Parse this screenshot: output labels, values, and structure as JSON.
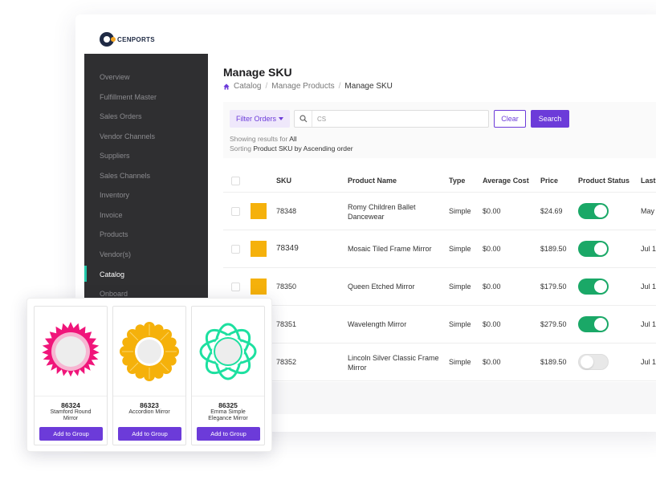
{
  "brand": {
    "name": "CENPORTS"
  },
  "sidebar": {
    "items": [
      {
        "label": "Overview"
      },
      {
        "label": "Fulfillment Master"
      },
      {
        "label": "Sales Orders"
      },
      {
        "label": "Vendor Channels"
      },
      {
        "label": "Suppliers"
      },
      {
        "label": "Sales Channels"
      },
      {
        "label": "Inventory"
      },
      {
        "label": "Invoice"
      },
      {
        "label": "Products"
      },
      {
        "label": "Vendor(s)"
      },
      {
        "label": "Catalog",
        "active": true
      },
      {
        "label": "Onboard"
      }
    ],
    "active_color": "#22c7a9"
  },
  "page": {
    "title": "Manage SKU",
    "breadcrumb": [
      "Catalog",
      "Manage Products",
      "Manage SKU"
    ]
  },
  "toolbar": {
    "filter_label": "Filter Orders",
    "search_value": "CS",
    "clear_label": "Clear",
    "search_label": "Search",
    "showing_prefix": "Showing results for",
    "showing_value": "All",
    "sorting_prefix": "Sorting",
    "sorting_value": "Product SKU by Ascending order"
  },
  "table": {
    "headers": {
      "sku": "SKU",
      "name": "Product Name",
      "type": "Type",
      "cost": "Average Cost",
      "price": "Price",
      "status": "Product Status",
      "last": "Last"
    },
    "rows": [
      {
        "sku": "78348",
        "name1": "Romy Children Ballet",
        "name2": "Dancewear",
        "type": "Simple",
        "cost": "$0.00",
        "price": "$24.69",
        "status_on": true,
        "last": "May"
      },
      {
        "sku": "78349",
        "name1": "Mosaic Tiled Frame Mirror",
        "name2": "",
        "type": "Simple",
        "cost": "$0.00",
        "price": "$189.50",
        "status_on": true,
        "last": "Jul 1"
      },
      {
        "sku": "78350",
        "name1": "Queen Etched Mirror",
        "name2": "",
        "type": "Simple",
        "cost": "$0.00",
        "price": "$179.50",
        "status_on": true,
        "last": "Jul 1"
      },
      {
        "sku": "78351",
        "name1": "Wavelength Mirror",
        "name2": "",
        "type": "Simple",
        "cost": "$0.00",
        "price": "$279.50",
        "status_on": true,
        "last": "Jul 1"
      },
      {
        "sku": "78352",
        "name1": "Lincoln Silver Classic Frame",
        "name2": "Mirror",
        "type": "Simple",
        "cost": "$0.00",
        "price": "$189.50",
        "status_on": false,
        "last": "Jul 1"
      }
    ]
  },
  "cards": [
    {
      "code": "86324",
      "name1": "Stamford Round",
      "name2": "Mirror",
      "button": "Add to Group",
      "icon": "sunburst-mirror-pink",
      "color": "#f0157a"
    },
    {
      "code": "86323",
      "name1": "Accordion Mirror",
      "name2": "",
      "button": "Add to Group",
      "icon": "accordion-mirror-yellow",
      "color": "#f5b10b"
    },
    {
      "code": "86325",
      "name1": "Emma Simple",
      "name2": "Elegance Mirror",
      "button": "Add to Group",
      "icon": "floral-mirror-green",
      "color": "#1de0a0"
    }
  ],
  "colors": {
    "accent": "#6c3bd9",
    "toggle_on": "#1aa867",
    "thumbnail": "#f5b10b"
  }
}
